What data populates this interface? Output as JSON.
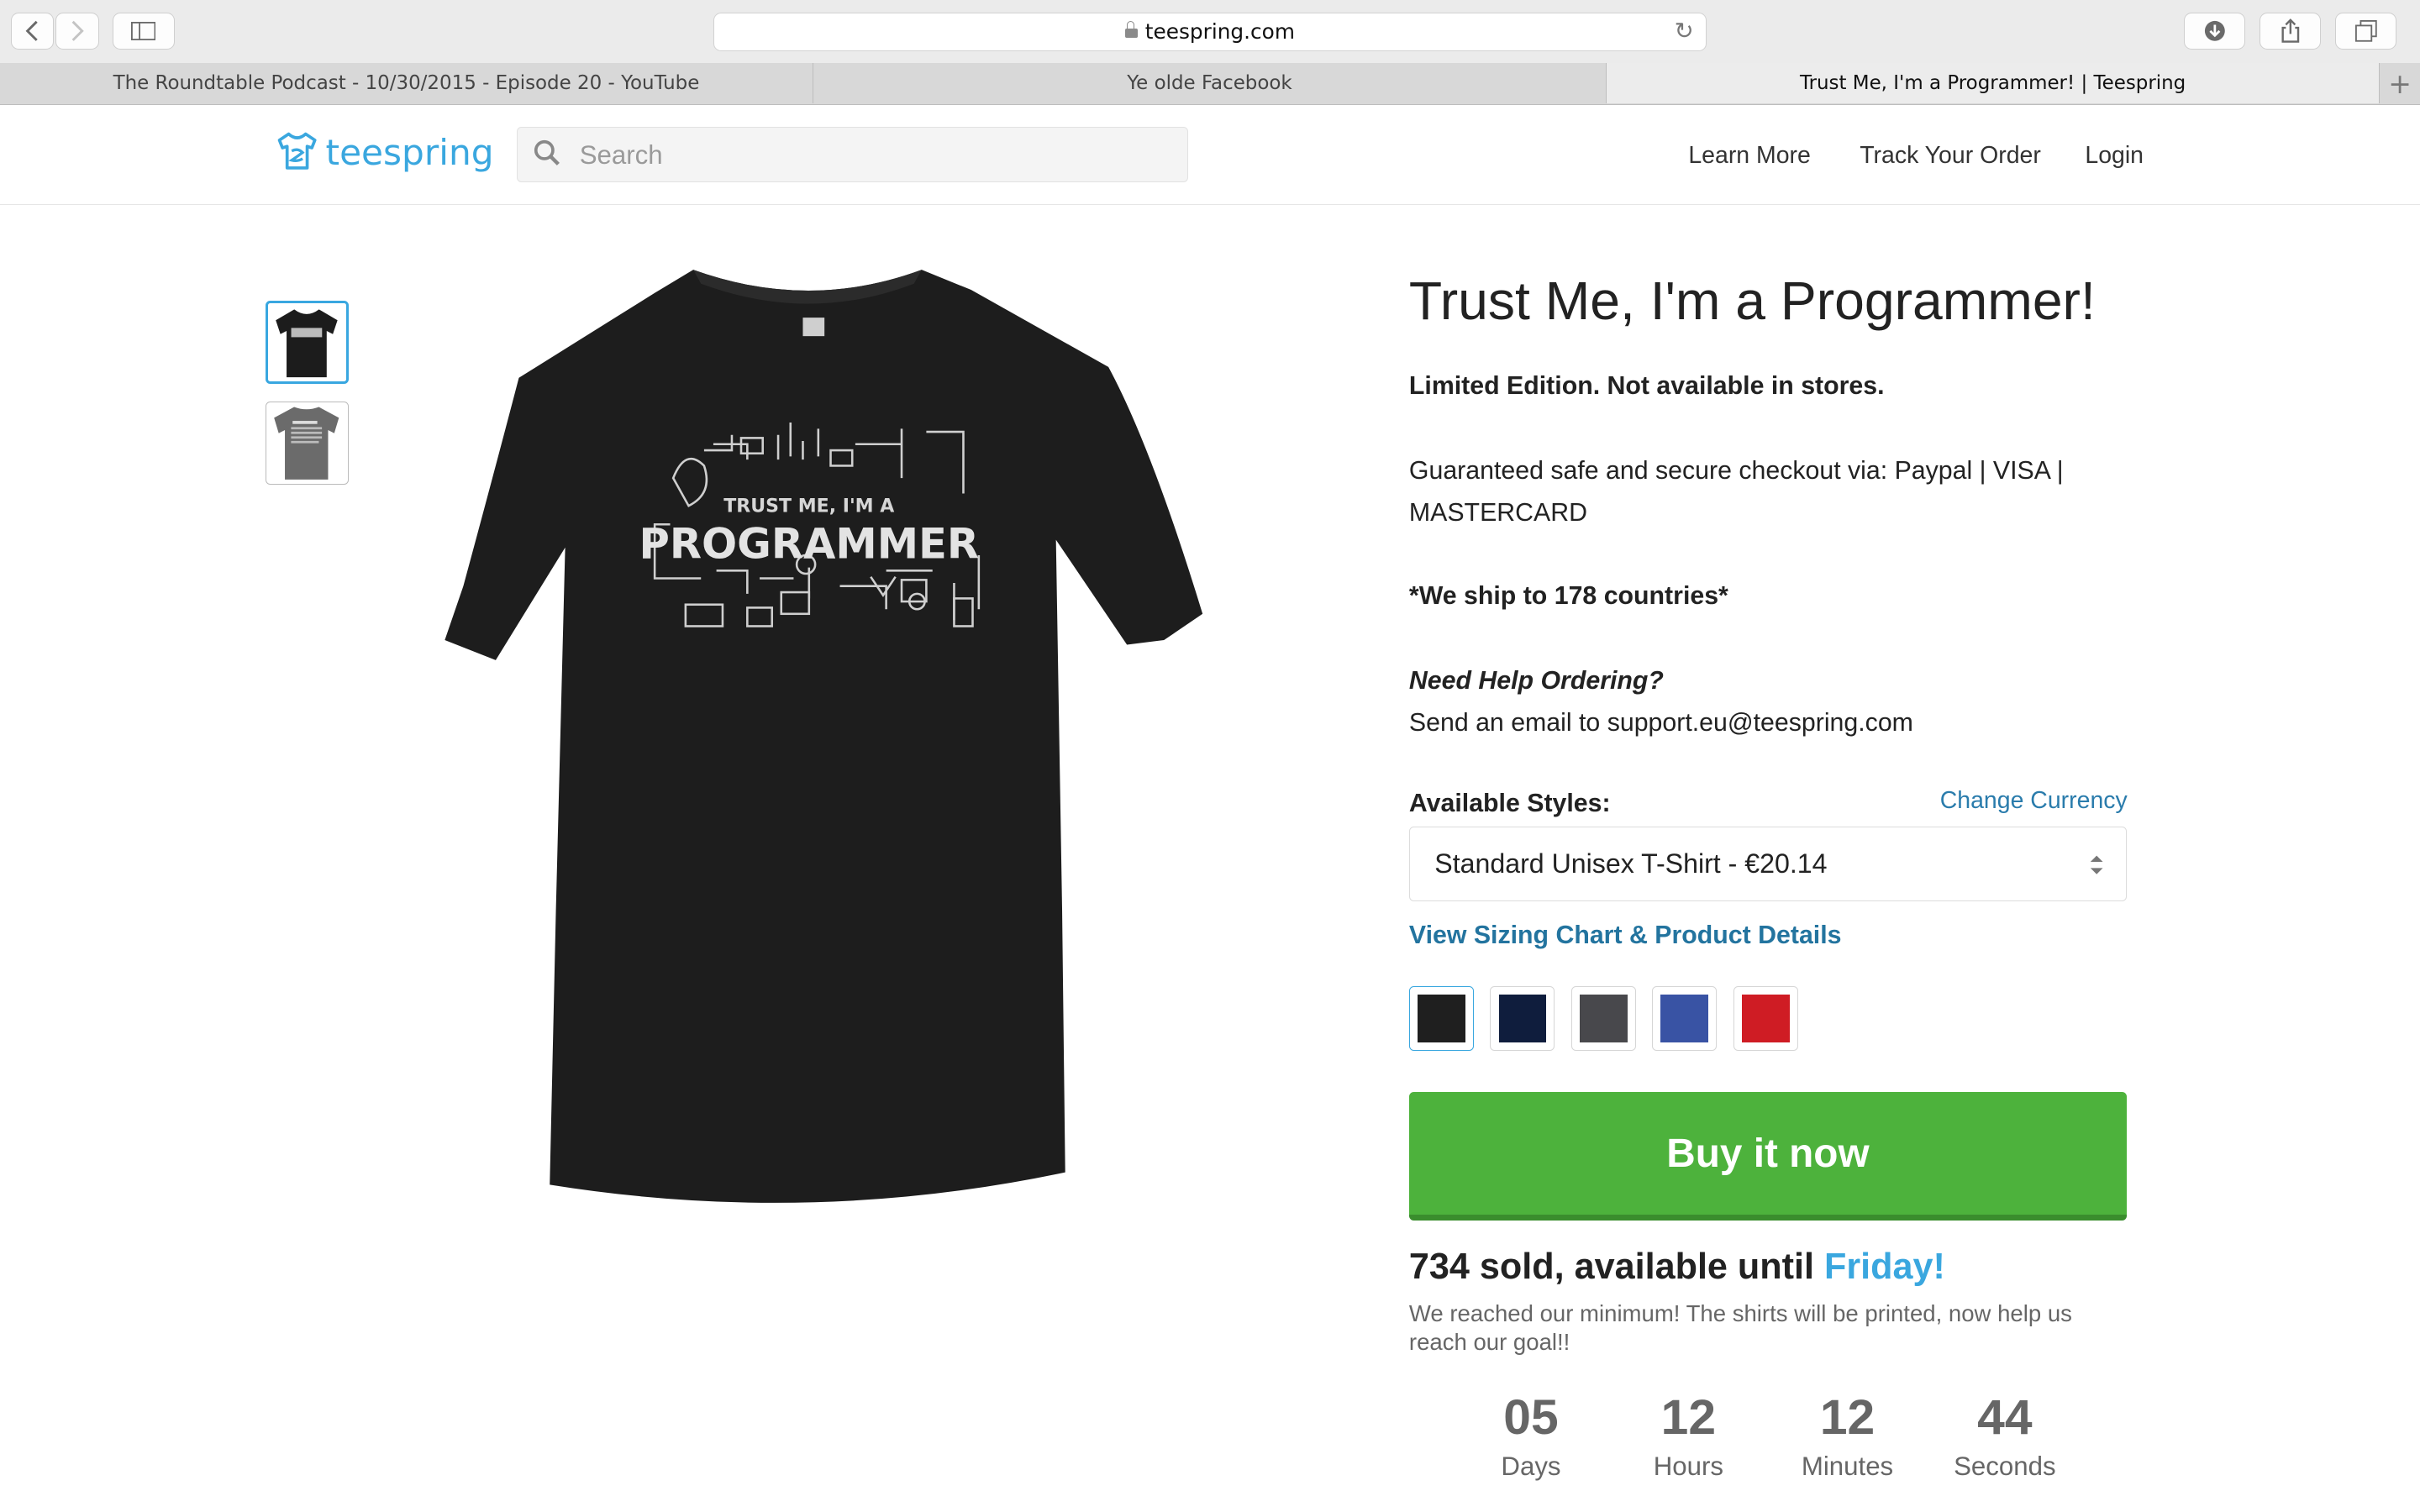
{
  "browser": {
    "url": "teespring.com",
    "tabs": [
      "The Roundtable Podcast - 10/30/2015 - Episode 20 - YouTube",
      "Ye olde Facebook",
      "Trust Me, I'm a Programmer! | Teespring"
    ],
    "active_tab": 2
  },
  "header": {
    "logo": "teespring",
    "search_placeholder": "Search",
    "nav": [
      "Learn More",
      "Track Your Order",
      "Login"
    ]
  },
  "product": {
    "title": "Trust Me, I'm a Programmer!",
    "limited": "Limited Edition. Not available in stores.",
    "checkout": "Guaranteed safe and secure checkout via: Paypal | VISA | MASTERCARD",
    "ship": "*We ship to 178 countries*",
    "help_title": "Need Help Ordering?",
    "help_text": "Send an email to support.eu@teespring.com",
    "styles_label": "Available Styles:",
    "change_currency": "Change Currency",
    "selected_style": "Standard Unisex T-Shirt - €20.14",
    "sizing_link": "View Sizing Chart & Product Details",
    "colors": [
      "#1f1f1f",
      "#0f1d3d",
      "#48484c",
      "#3953a4",
      "#cf1c24"
    ],
    "selected_color": 0,
    "buy_label": "Buy it now",
    "sold_prefix": "734 sold, available until ",
    "sold_day": "Friday!",
    "minimum_text": "We reached our minimum! The shirts will be printed, now help us reach our goal!!",
    "shirt_print_top": "TRUST ME, I'M A",
    "shirt_print_main": "PROGRAMMER"
  },
  "countdown": [
    {
      "value": "05",
      "label": "Days"
    },
    {
      "value": "12",
      "label": "Hours"
    },
    {
      "value": "12",
      "label": "Minutes"
    },
    {
      "value": "44",
      "label": "Seconds"
    }
  ]
}
